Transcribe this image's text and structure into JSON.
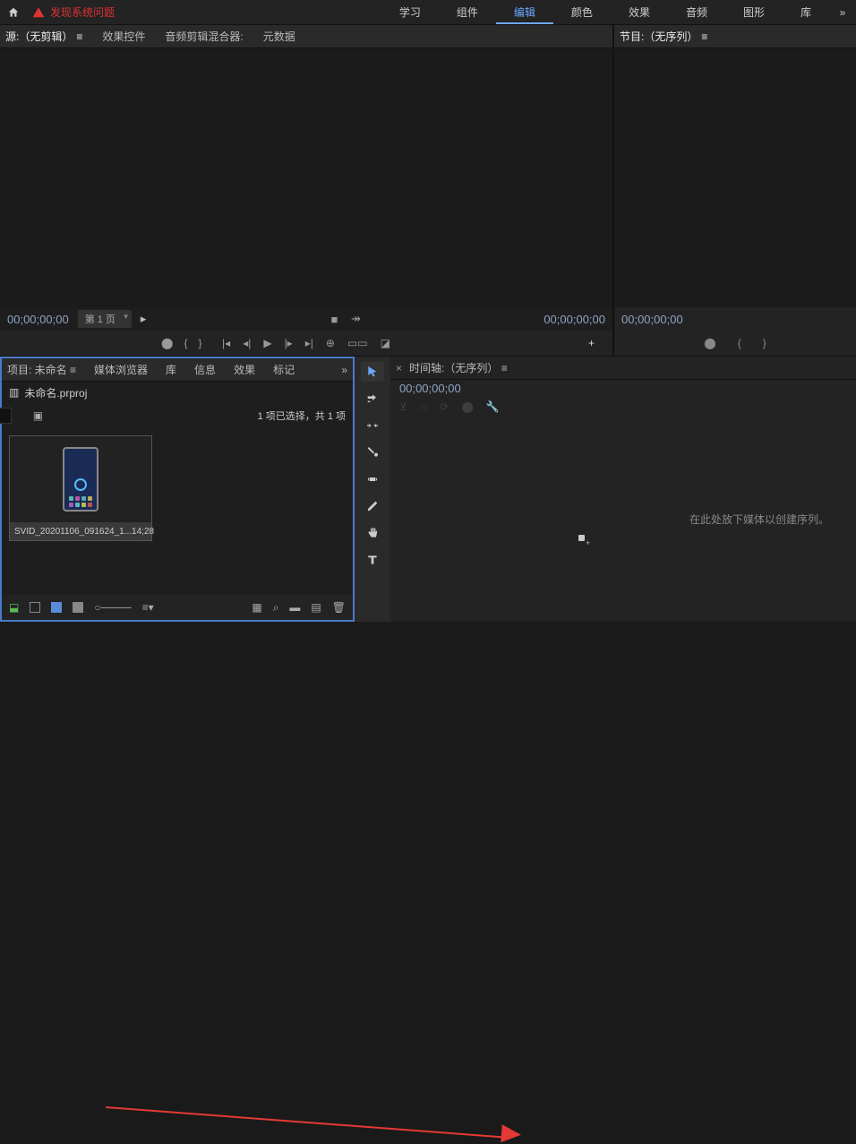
{
  "top": {
    "warning": "发现系统问题",
    "nav": [
      "学习",
      "组件",
      "编辑",
      "颜色",
      "效果",
      "音频",
      "图形",
      "库"
    ],
    "active_nav": "编辑"
  },
  "source": {
    "tabs": {
      "source": "源:（无剪辑）",
      "effect_controls": "效果控件",
      "audio_mixer": "音频剪辑混合器:",
      "metadata": "元数据"
    },
    "tc_left": "00;00;00;00",
    "page": "第 1 页",
    "tc_right": "00;00;00;00"
  },
  "program": {
    "tab": "节目:（无序列）",
    "tc": "00;00;00;00"
  },
  "project": {
    "tabs": {
      "project": "项目: 未命名",
      "browser": "媒体浏览器",
      "lib": "库",
      "info": "信息",
      "effects": "效果",
      "markers": "标记"
    },
    "name": "未命名.prproj",
    "count": "1 项已选择，共 1 项",
    "clip": {
      "name": "SVID_20201106_091624_1...",
      "dur": "14;28"
    }
  },
  "timeline": {
    "tab": "时间轴:（无序列）",
    "tc": "00;00;00;00",
    "empty": "在此处放下媒体以创建序列。"
  },
  "icons": {
    "selection": "selection-tool",
    "track_fwd": "track-select-fwd",
    "ripple": "ripple-edit",
    "razor": "razor",
    "slip": "slip",
    "pen": "pen",
    "hand": "hand",
    "type": "type"
  }
}
